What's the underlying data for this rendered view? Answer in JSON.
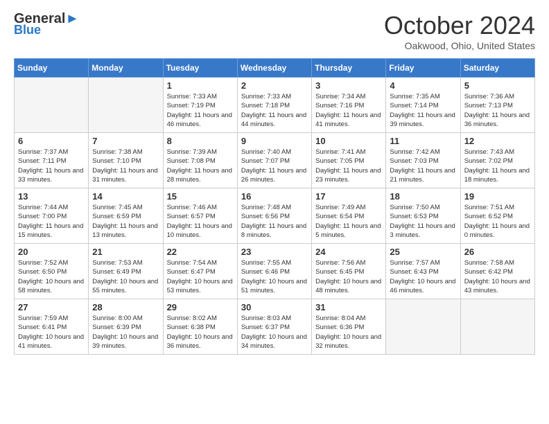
{
  "header": {
    "logo_line1": "General",
    "logo_line2": "Blue",
    "month": "October 2024",
    "location": "Oakwood, Ohio, United States"
  },
  "weekdays": [
    "Sunday",
    "Monday",
    "Tuesday",
    "Wednesday",
    "Thursday",
    "Friday",
    "Saturday"
  ],
  "weeks": [
    [
      {
        "day": "",
        "sunrise": "",
        "sunset": "",
        "daylight": "",
        "empty": true
      },
      {
        "day": "",
        "sunrise": "",
        "sunset": "",
        "daylight": "",
        "empty": true
      },
      {
        "day": "1",
        "sunrise": "Sunrise: 7:33 AM",
        "sunset": "Sunset: 7:19 PM",
        "daylight": "Daylight: 11 hours and 46 minutes.",
        "empty": false
      },
      {
        "day": "2",
        "sunrise": "Sunrise: 7:33 AM",
        "sunset": "Sunset: 7:18 PM",
        "daylight": "Daylight: 11 hours and 44 minutes.",
        "empty": false
      },
      {
        "day": "3",
        "sunrise": "Sunrise: 7:34 AM",
        "sunset": "Sunset: 7:16 PM",
        "daylight": "Daylight: 11 hours and 41 minutes.",
        "empty": false
      },
      {
        "day": "4",
        "sunrise": "Sunrise: 7:35 AM",
        "sunset": "Sunset: 7:14 PM",
        "daylight": "Daylight: 11 hours and 39 minutes.",
        "empty": false
      },
      {
        "day": "5",
        "sunrise": "Sunrise: 7:36 AM",
        "sunset": "Sunset: 7:13 PM",
        "daylight": "Daylight: 11 hours and 36 minutes.",
        "empty": false
      }
    ],
    [
      {
        "day": "6",
        "sunrise": "Sunrise: 7:37 AM",
        "sunset": "Sunset: 7:11 PM",
        "daylight": "Daylight: 11 hours and 33 minutes.",
        "empty": false
      },
      {
        "day": "7",
        "sunrise": "Sunrise: 7:38 AM",
        "sunset": "Sunset: 7:10 PM",
        "daylight": "Daylight: 11 hours and 31 minutes.",
        "empty": false
      },
      {
        "day": "8",
        "sunrise": "Sunrise: 7:39 AM",
        "sunset": "Sunset: 7:08 PM",
        "daylight": "Daylight: 11 hours and 28 minutes.",
        "empty": false
      },
      {
        "day": "9",
        "sunrise": "Sunrise: 7:40 AM",
        "sunset": "Sunset: 7:07 PM",
        "daylight": "Daylight: 11 hours and 26 minutes.",
        "empty": false
      },
      {
        "day": "10",
        "sunrise": "Sunrise: 7:41 AM",
        "sunset": "Sunset: 7:05 PM",
        "daylight": "Daylight: 11 hours and 23 minutes.",
        "empty": false
      },
      {
        "day": "11",
        "sunrise": "Sunrise: 7:42 AM",
        "sunset": "Sunset: 7:03 PM",
        "daylight": "Daylight: 11 hours and 21 minutes.",
        "empty": false
      },
      {
        "day": "12",
        "sunrise": "Sunrise: 7:43 AM",
        "sunset": "Sunset: 7:02 PM",
        "daylight": "Daylight: 11 hours and 18 minutes.",
        "empty": false
      }
    ],
    [
      {
        "day": "13",
        "sunrise": "Sunrise: 7:44 AM",
        "sunset": "Sunset: 7:00 PM",
        "daylight": "Daylight: 11 hours and 15 minutes.",
        "empty": false
      },
      {
        "day": "14",
        "sunrise": "Sunrise: 7:45 AM",
        "sunset": "Sunset: 6:59 PM",
        "daylight": "Daylight: 11 hours and 13 minutes.",
        "empty": false
      },
      {
        "day": "15",
        "sunrise": "Sunrise: 7:46 AM",
        "sunset": "Sunset: 6:57 PM",
        "daylight": "Daylight: 11 hours and 10 minutes.",
        "empty": false
      },
      {
        "day": "16",
        "sunrise": "Sunrise: 7:48 AM",
        "sunset": "Sunset: 6:56 PM",
        "daylight": "Daylight: 11 hours and 8 minutes.",
        "empty": false
      },
      {
        "day": "17",
        "sunrise": "Sunrise: 7:49 AM",
        "sunset": "Sunset: 6:54 PM",
        "daylight": "Daylight: 11 hours and 5 minutes.",
        "empty": false
      },
      {
        "day": "18",
        "sunrise": "Sunrise: 7:50 AM",
        "sunset": "Sunset: 6:53 PM",
        "daylight": "Daylight: 11 hours and 3 minutes.",
        "empty": false
      },
      {
        "day": "19",
        "sunrise": "Sunrise: 7:51 AM",
        "sunset": "Sunset: 6:52 PM",
        "daylight": "Daylight: 11 hours and 0 minutes.",
        "empty": false
      }
    ],
    [
      {
        "day": "20",
        "sunrise": "Sunrise: 7:52 AM",
        "sunset": "Sunset: 6:50 PM",
        "daylight": "Daylight: 10 hours and 58 minutes.",
        "empty": false
      },
      {
        "day": "21",
        "sunrise": "Sunrise: 7:53 AM",
        "sunset": "Sunset: 6:49 PM",
        "daylight": "Daylight: 10 hours and 55 minutes.",
        "empty": false
      },
      {
        "day": "22",
        "sunrise": "Sunrise: 7:54 AM",
        "sunset": "Sunset: 6:47 PM",
        "daylight": "Daylight: 10 hours and 53 minutes.",
        "empty": false
      },
      {
        "day": "23",
        "sunrise": "Sunrise: 7:55 AM",
        "sunset": "Sunset: 6:46 PM",
        "daylight": "Daylight: 10 hours and 51 minutes.",
        "empty": false
      },
      {
        "day": "24",
        "sunrise": "Sunrise: 7:56 AM",
        "sunset": "Sunset: 6:45 PM",
        "daylight": "Daylight: 10 hours and 48 minutes.",
        "empty": false
      },
      {
        "day": "25",
        "sunrise": "Sunrise: 7:57 AM",
        "sunset": "Sunset: 6:43 PM",
        "daylight": "Daylight: 10 hours and 46 minutes.",
        "empty": false
      },
      {
        "day": "26",
        "sunrise": "Sunrise: 7:58 AM",
        "sunset": "Sunset: 6:42 PM",
        "daylight": "Daylight: 10 hours and 43 minutes.",
        "empty": false
      }
    ],
    [
      {
        "day": "27",
        "sunrise": "Sunrise: 7:59 AM",
        "sunset": "Sunset: 6:41 PM",
        "daylight": "Daylight: 10 hours and 41 minutes.",
        "empty": false
      },
      {
        "day": "28",
        "sunrise": "Sunrise: 8:00 AM",
        "sunset": "Sunset: 6:39 PM",
        "daylight": "Daylight: 10 hours and 39 minutes.",
        "empty": false
      },
      {
        "day": "29",
        "sunrise": "Sunrise: 8:02 AM",
        "sunset": "Sunset: 6:38 PM",
        "daylight": "Daylight: 10 hours and 36 minutes.",
        "empty": false
      },
      {
        "day": "30",
        "sunrise": "Sunrise: 8:03 AM",
        "sunset": "Sunset: 6:37 PM",
        "daylight": "Daylight: 10 hours and 34 minutes.",
        "empty": false
      },
      {
        "day": "31",
        "sunrise": "Sunrise: 8:04 AM",
        "sunset": "Sunset: 6:36 PM",
        "daylight": "Daylight: 10 hours and 32 minutes.",
        "empty": false
      },
      {
        "day": "",
        "sunrise": "",
        "sunset": "",
        "daylight": "",
        "empty": true
      },
      {
        "day": "",
        "sunrise": "",
        "sunset": "",
        "daylight": "",
        "empty": true
      }
    ]
  ]
}
